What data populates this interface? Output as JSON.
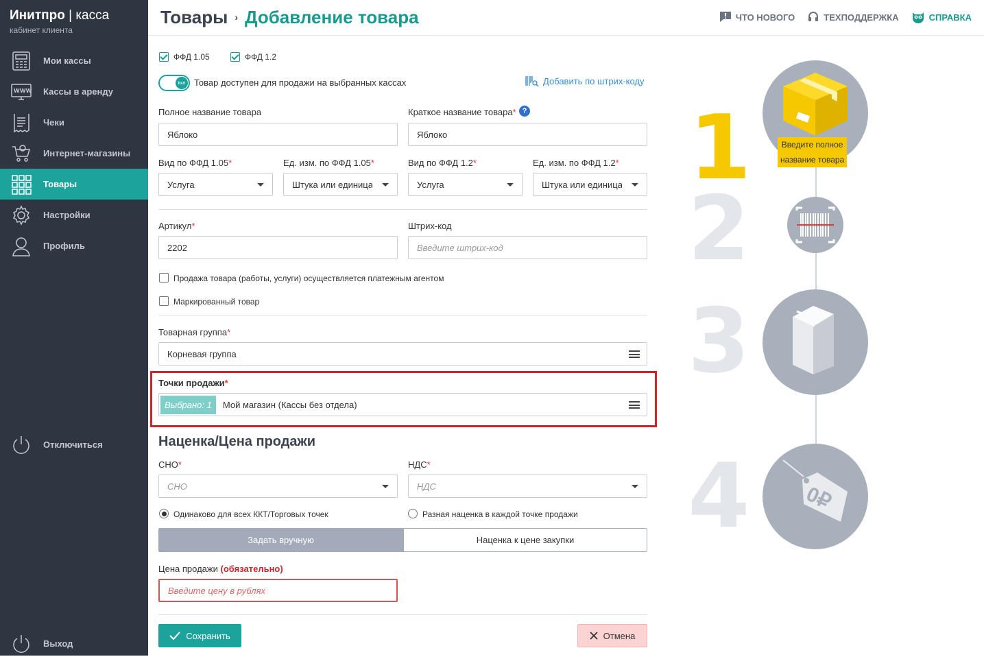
{
  "app": {
    "brand": "Инитпро",
    "brand_sep": "|",
    "brand_suffix": "касса",
    "subtitle": "кабинет клиента"
  },
  "sidebar": {
    "items": [
      {
        "label": "Мои кассы",
        "icon": "cash-register-icon"
      },
      {
        "label": "Кассы в аренду",
        "icon": "www-monitor-icon"
      },
      {
        "label": "Чеки",
        "icon": "receipt-icon"
      },
      {
        "label": "Интернет-магазины",
        "icon": "cart-icon"
      },
      {
        "label": "Товары",
        "icon": "grid-icon",
        "active": true
      },
      {
        "label": "Настройки",
        "icon": "gear-icon"
      },
      {
        "label": "Профиль",
        "icon": "user-icon"
      }
    ],
    "disconnect": "Отключиться",
    "logout": "Выход"
  },
  "header": {
    "crumb1": "Товары",
    "crumb_sep": "›",
    "crumb2": "Добавление товара",
    "links": {
      "news": "ЧТО НОВОГО",
      "support": "ТЕХПОДДЕРЖКА",
      "help": "СПРАВКА"
    }
  },
  "form": {
    "ffd105": "ФФД 1.05",
    "ffd12": "ФФД 1.2",
    "toggle_text": "вкл",
    "toggle_label": "Товар доступен для продажи на выбранных кассах",
    "barcode_link": "Добавить по штрих-коду",
    "full_name_label": "Полное название товара",
    "full_name_value": "Яблоко",
    "short_name_label": "Краткое название товара",
    "short_name_value": "Яблоко",
    "req_mark": "*",
    "kind105_label": "Вид по ФФД 1.05",
    "kind105_value": "Услуга",
    "unit105_label": "Ед. изм. по ФФД 1.05",
    "unit105_value": "Штука или единица",
    "kind12_label": "Вид по ФФД 1.2",
    "kind12_value": "Услуга",
    "unit12_label": "Ед. изм. по ФФД 1.2",
    "unit12_value": "Штука или единица",
    "article_label": "Артикул",
    "article_value": "2202",
    "barcode_label": "Штрих-код",
    "barcode_placeholder": "Введите штрих-код",
    "agent_label": "Продажа товара (работы, услуги) осуществляется платежным агентом",
    "marked_label": "Маркированный товар",
    "group_label": "Товарная группа",
    "group_value": "Корневая группа",
    "points_label": "Точки продажи",
    "points_badge": "Выбрано: 1",
    "points_value": "Мой магазин (Кассы без отдела)",
    "markup_title": "Наценка/Цена продажи",
    "sno_label": "СНО",
    "sno_placeholder": "СНО",
    "nds_label": "НДС",
    "nds_placeholder": "НДС",
    "radio_same": "Одинаково для всех ККТ/Торговых точек",
    "radio_diff": "Разная наценка в каждой точке продажи",
    "tab_manual": "Задать вручную",
    "tab_markup": "Наценка к цене закупки",
    "price_label": "Цена продажи",
    "price_req": "(обязательно)",
    "price_placeholder": "Введите цену в рублях",
    "save": "Сохранить",
    "cancel": "Отмена"
  },
  "steps": {
    "n1": "1",
    "n2": "2",
    "n3": "3",
    "n4": "4",
    "tip_line1": "Введите полное",
    "tip_line2": "название товара",
    "price_tag": "0₽"
  },
  "colors": {
    "accent": "#1ba39c",
    "sidebar": "#2f3541",
    "step_yellow": "#f5c800",
    "highlight": "#d3222a"
  }
}
